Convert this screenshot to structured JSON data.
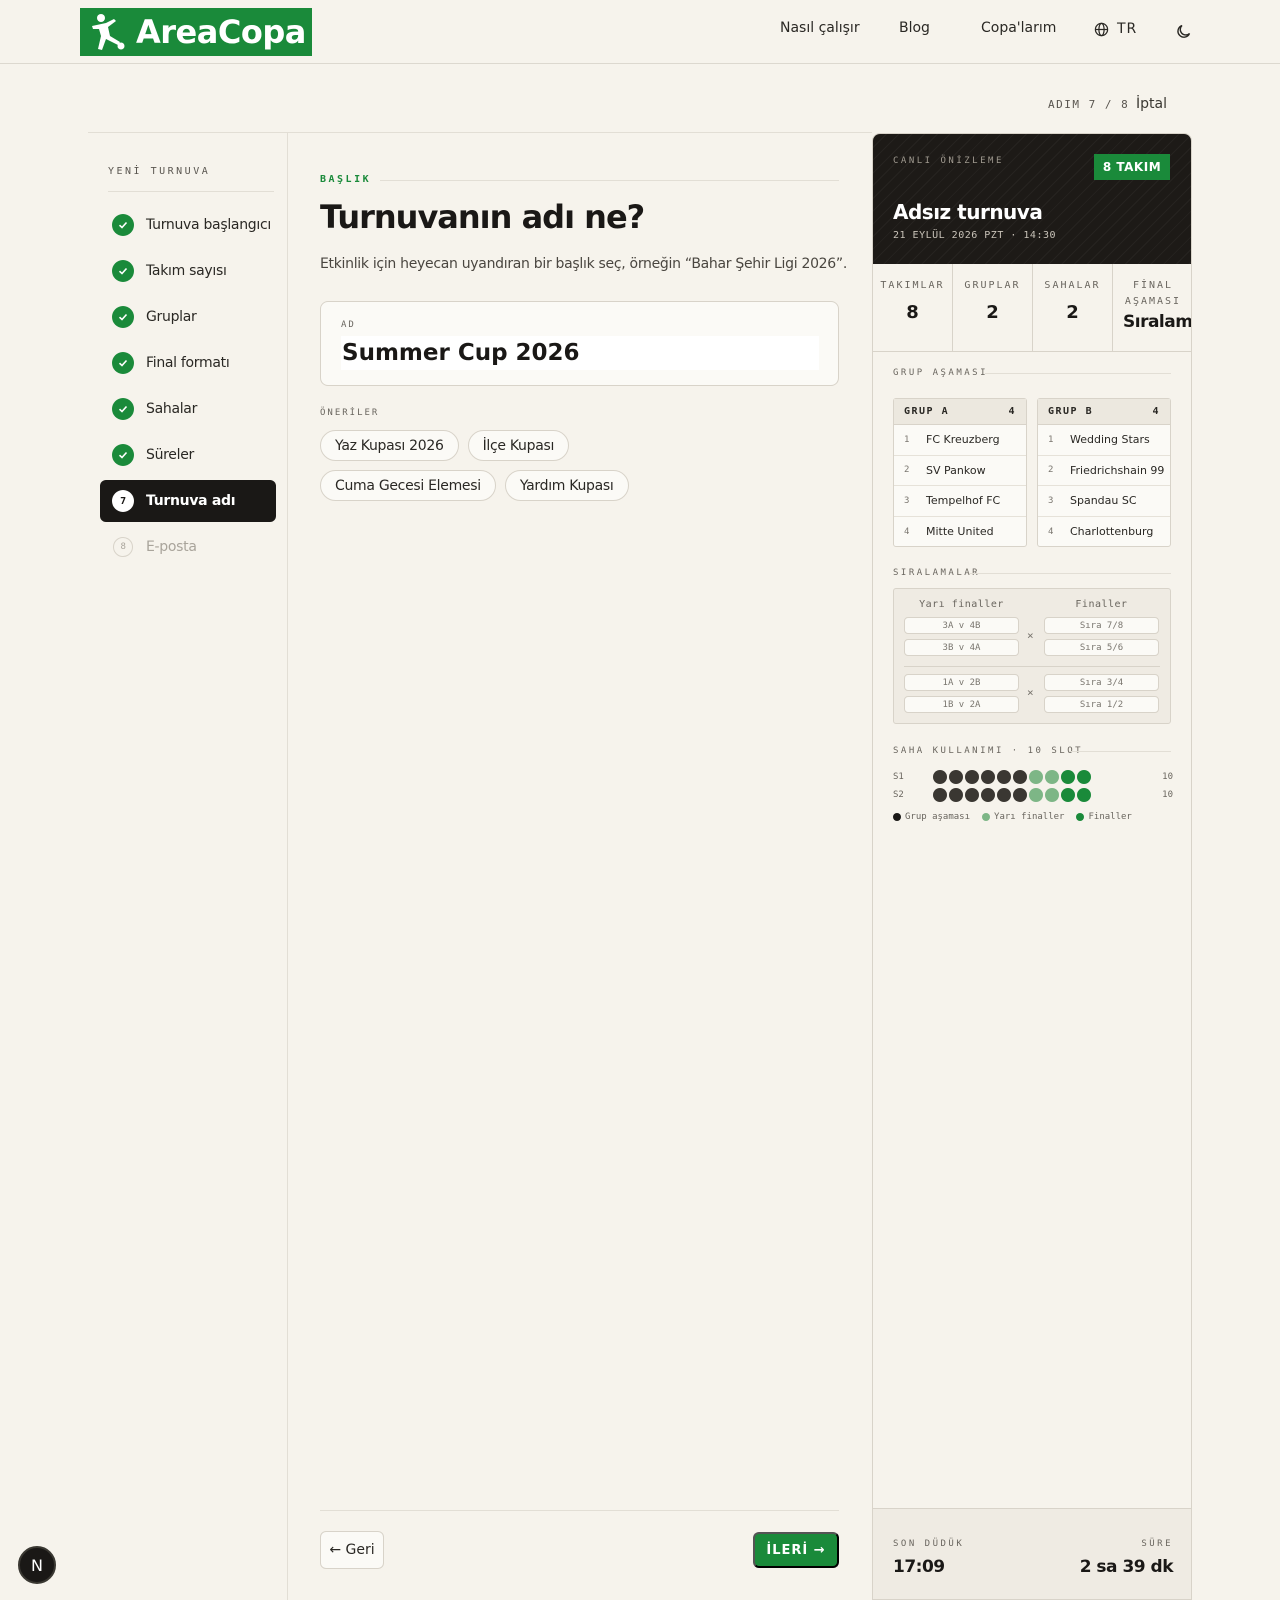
{
  "header": {
    "logo_text": "AreaCopa",
    "nav": [
      "Nasıl çalışır",
      "Blog",
      "Copa'larım"
    ],
    "language": "TR"
  },
  "wizard": {
    "step_counter": "ADIM 7 / 8",
    "cancel_label": "İptal"
  },
  "sidebar": {
    "title": "YENİ TURNUVA",
    "steps": [
      {
        "label": "Turnuva başlangıcı",
        "state": "done"
      },
      {
        "label": "Takım sayısı",
        "state": "done"
      },
      {
        "label": "Gruplar",
        "state": "done"
      },
      {
        "label": "Final formatı",
        "state": "done"
      },
      {
        "label": "Sahalar",
        "state": "done"
      },
      {
        "label": "Süreler",
        "state": "done"
      },
      {
        "label": "Turnuva adı",
        "state": "active",
        "number": "7"
      },
      {
        "label": "E-posta",
        "state": "todo",
        "number": "8"
      }
    ]
  },
  "main": {
    "section_label": "BAŞLIK",
    "title": "Turnuvanın adı ne?",
    "description": "Etkinlik için heyecan uyandıran bir başlık seç, örneğin “Bahar Şehir Ligi 2026”.",
    "name_field": {
      "label": "AD",
      "value": "Summer Cup 2026"
    },
    "suggestions_label": "ÖNERİLER",
    "suggestions": [
      "Yaz Kupası 2026",
      "İlçe Kupası",
      "Cuma Gecesi Elemesi",
      "Yardım Kupası"
    ],
    "back_label": "← Geri",
    "next_label": "İLERİ →"
  },
  "preview": {
    "live_label": "CANLI ÖNİZLEME",
    "badge": "8 TAKIM",
    "title": "Adsız turnuva",
    "date": "21 EYLÜL 2026 PZT · 14:30",
    "stats": [
      {
        "label": "TAKIMLAR",
        "value": "8"
      },
      {
        "label": "GRUPLAR",
        "value": "2"
      },
      {
        "label": "SAHALAR",
        "value": "2"
      },
      {
        "label": "FİNAL AŞAMASI",
        "value": "Sıralama"
      }
    ],
    "group_stage_label": "GRUP AŞAMASI",
    "groups": [
      {
        "name": "GRUP A",
        "count": "4",
        "teams": [
          "FC Kreuzberg",
          "SV Pankow",
          "Tempelhof FC",
          "Mitte United"
        ]
      },
      {
        "name": "GRUP B",
        "count": "4",
        "teams": [
          "Wedding Stars",
          "Friedrichshain 99",
          "Spandau SC",
          "Charlottenburg"
        ]
      }
    ],
    "placements_label": "SIRALAMALAR",
    "semis_title": "Yarı finaller",
    "finals_title": "Finaller",
    "semis": [
      "3A v 4B",
      "3B v 4A",
      "1A v 2B",
      "1B v 2A"
    ],
    "finals": [
      "Sıra 7/8",
      "Sıra 5/6",
      "Sıra 3/4",
      "Sıra 1/2"
    ],
    "usage_label": "SAHA KULLANIMI · 10 SLOT",
    "usage": [
      {
        "field": "S1",
        "count": "10",
        "slots": [
          "g",
          "g",
          "g",
          "g",
          "g",
          "g",
          "s",
          "s",
          "f",
          "f"
        ]
      },
      {
        "field": "S2",
        "count": "10",
        "slots": [
          "g",
          "g",
          "g",
          "g",
          "g",
          "g",
          "s",
          "s",
          "f",
          "f"
        ]
      }
    ],
    "legend": [
      {
        "label": "Grup aşaması",
        "color": "#1a1816"
      },
      {
        "label": "Yarı finaller",
        "color": "#7db686"
      },
      {
        "label": "Finaller",
        "color": "#1a8a3a"
      }
    ],
    "end_label": "SON DÜDÜK",
    "end_value": "17:09",
    "duration_label": "SÜRE",
    "duration_value": "2 sa 39 dk"
  },
  "dev_badge": "N",
  "colors": {
    "accent": "#1a8a3a",
    "dark": "#1a1816",
    "background": "#f6f3ec"
  }
}
